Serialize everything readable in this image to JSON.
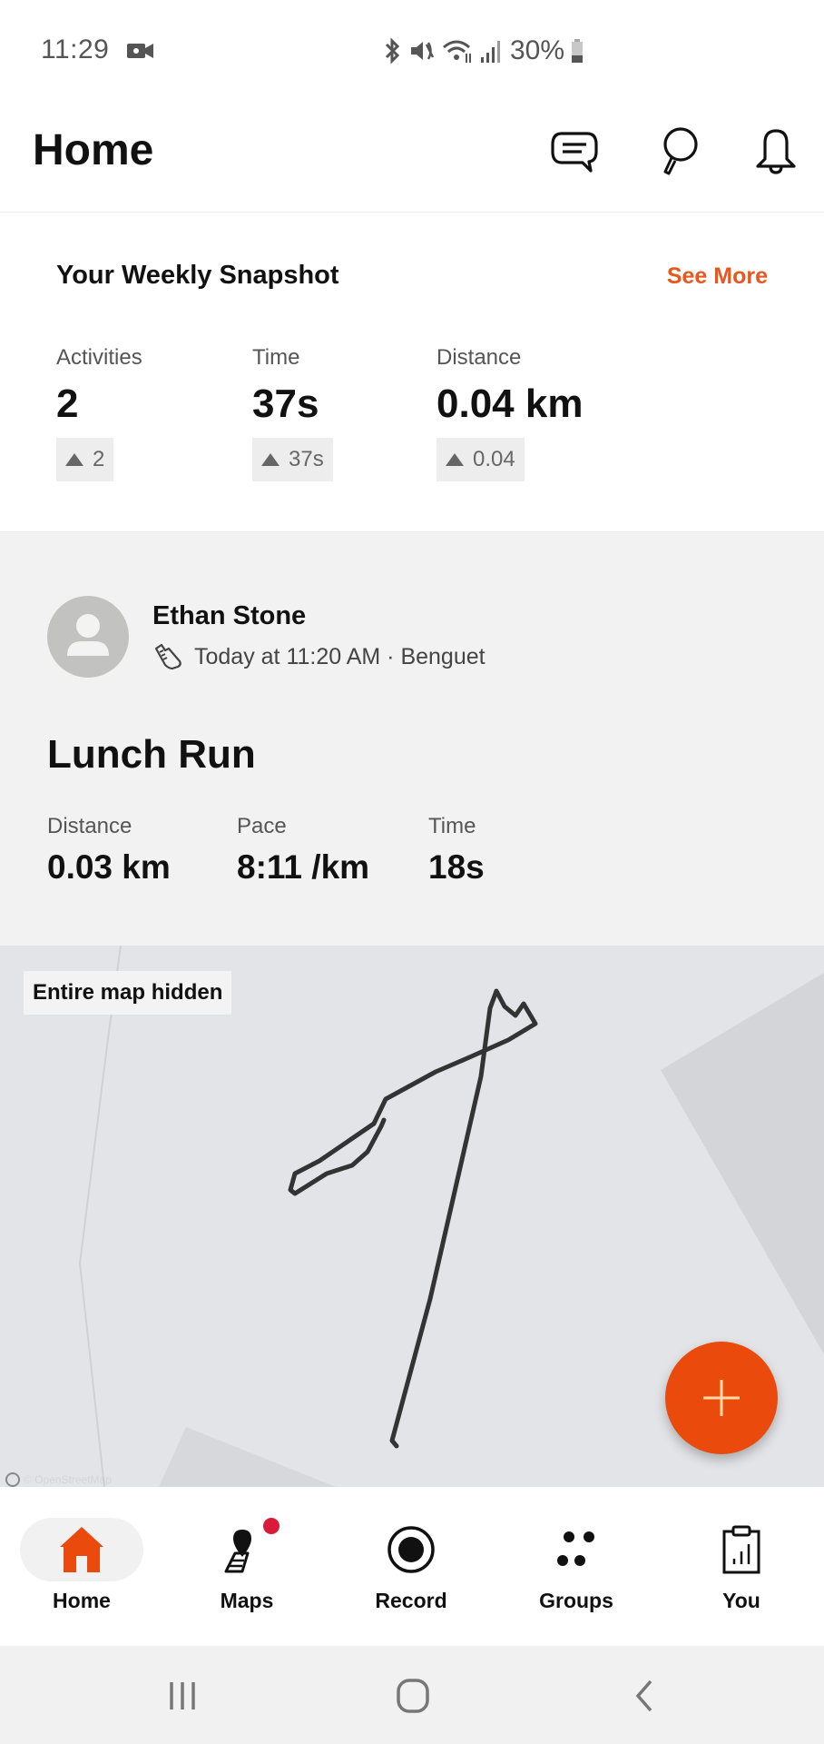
{
  "status_bar": {
    "time": "11:29",
    "battery_percent": "30%",
    "icons": [
      "screen-record-icon",
      "bluetooth-icon",
      "mute-icon",
      "wifi-icon",
      "signal-icon",
      "battery-icon"
    ]
  },
  "header": {
    "title": "Home",
    "actions": [
      "messages-icon",
      "search-icon",
      "notifications-icon"
    ]
  },
  "weekly_snapshot": {
    "title": "Your Weekly Snapshot",
    "see_more": "See More",
    "stats": [
      {
        "label": "Activities",
        "value": "2",
        "delta": "2"
      },
      {
        "label": "Time",
        "value": "37s",
        "delta": "37s"
      },
      {
        "label": "Distance",
        "value": "0.04 km",
        "delta": "0.04"
      }
    ]
  },
  "activity": {
    "athlete": "Ethan Stone",
    "meta": "Today at 11:20 AM · Benguet",
    "sport_icon": "running-shoe-icon",
    "title": "Lunch Run",
    "stats": [
      {
        "label": "Distance",
        "value": "0.03 km"
      },
      {
        "label": "Pace",
        "value": "8:11 /km"
      },
      {
        "label": "Time",
        "value": "18s"
      }
    ],
    "map_notice": "Entire map hidden",
    "map_attribution": "© OpenStreetMap"
  },
  "fab": {
    "icon": "plus-icon"
  },
  "bottom_nav": {
    "items": [
      {
        "label": "Home",
        "icon": "home-icon",
        "active": true
      },
      {
        "label": "Maps",
        "icon": "maps-icon",
        "badge": true
      },
      {
        "label": "Record",
        "icon": "record-icon"
      },
      {
        "label": "Groups",
        "icon": "groups-icon"
      },
      {
        "label": "You",
        "icon": "profile-stats-icon"
      }
    ]
  },
  "colors": {
    "accent": "#ea4a0c",
    "see_more": "#e8571e",
    "badge": "#d81b3a",
    "card_bg": "#f2f2f2",
    "map_bg": "#e3e4e7"
  }
}
